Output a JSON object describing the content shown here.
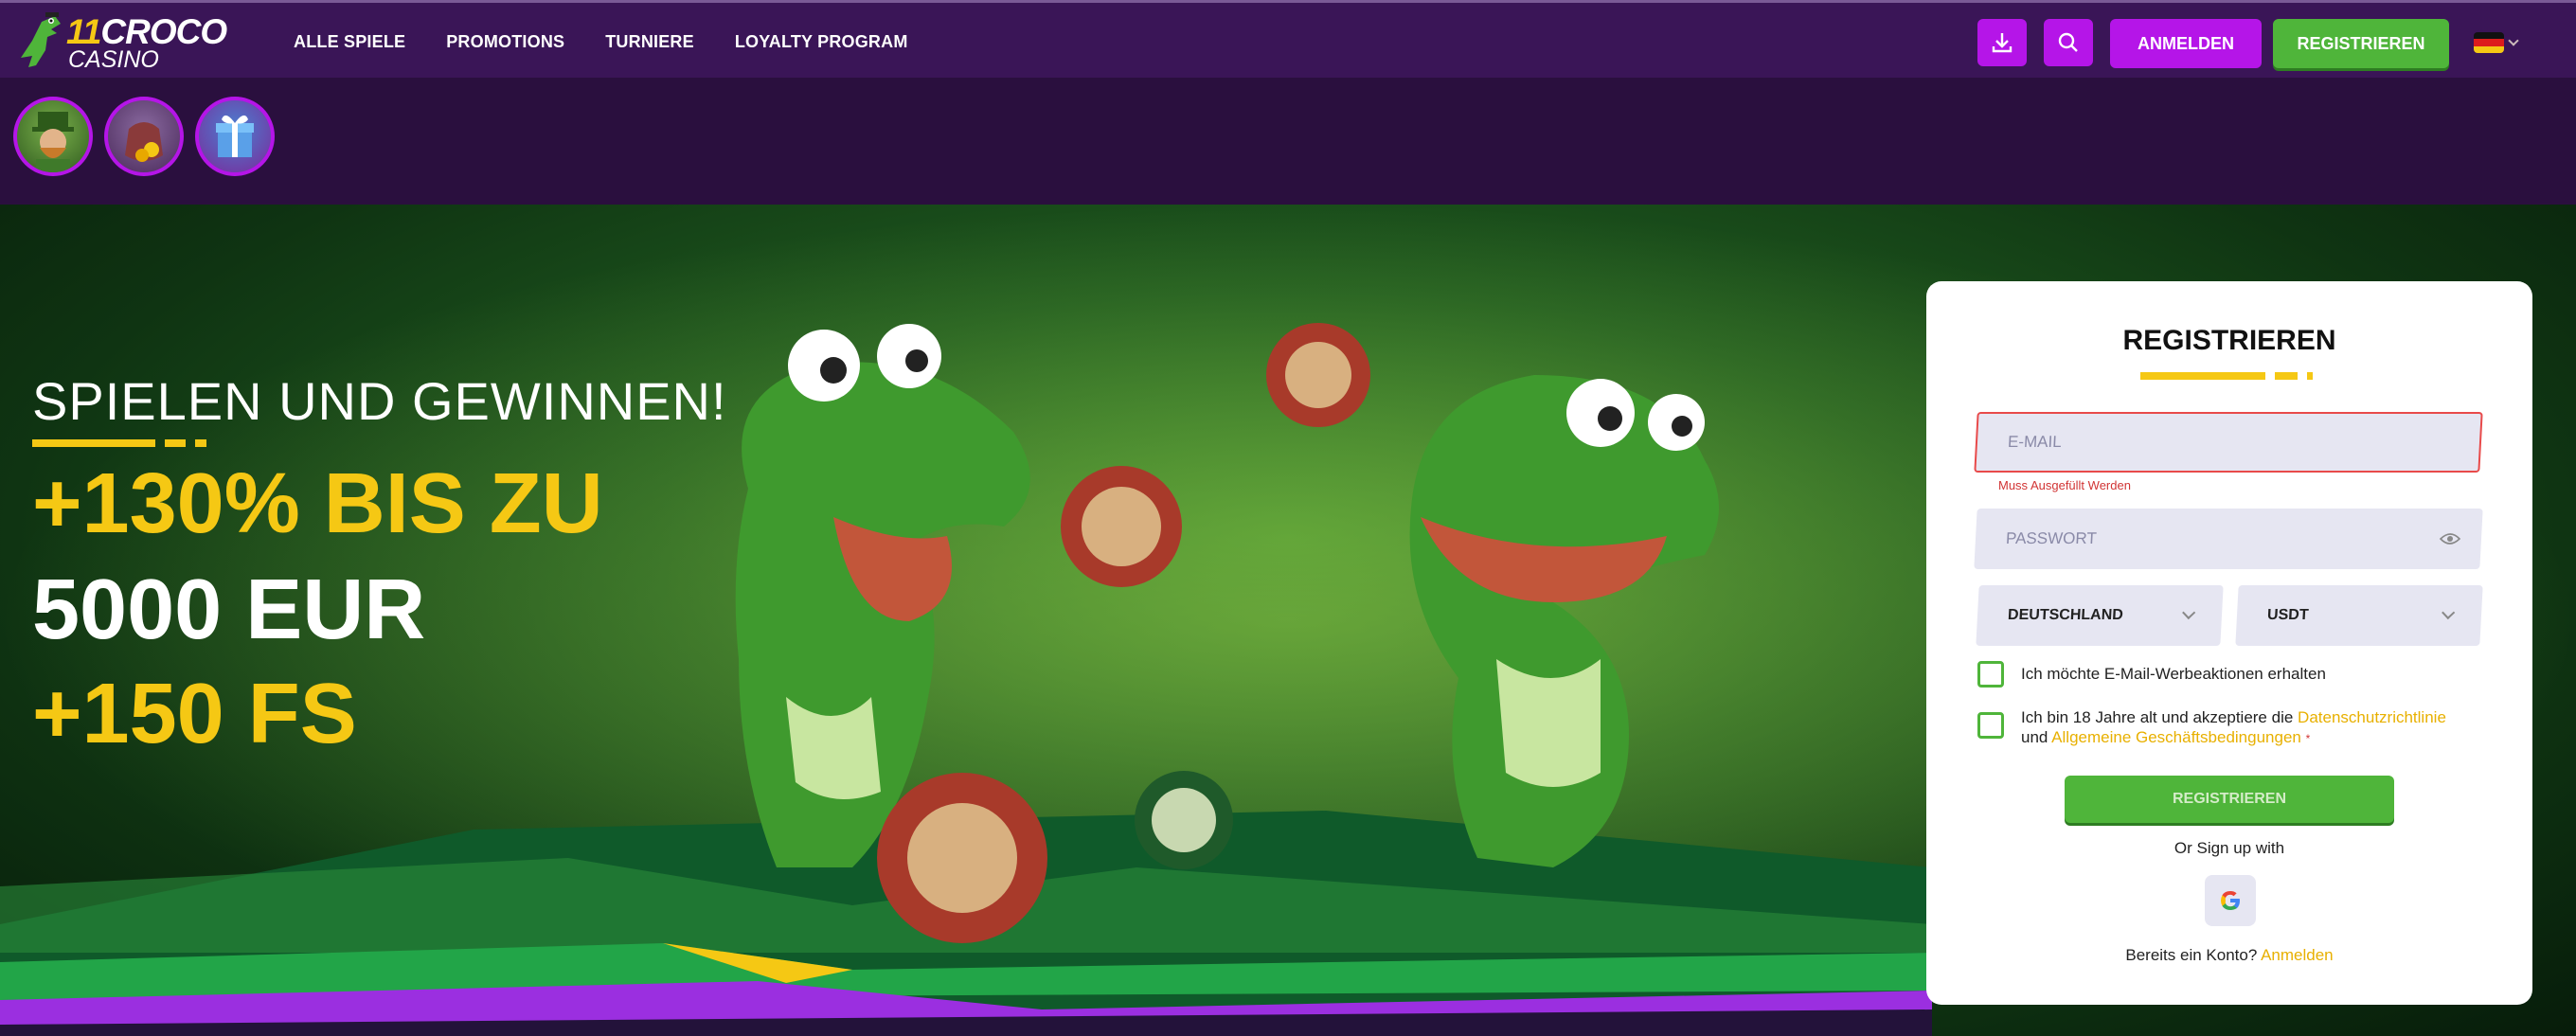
{
  "colors": {
    "brand_purple": "#b515e8",
    "brand_green": "#4fb53a",
    "accent_yellow": "#f5c814",
    "topbar_bg": "#3a1557"
  },
  "logo": {
    "number": "11",
    "word": "CROCO",
    "sub": "CASINO",
    "icon": "crocodile-logo-icon"
  },
  "nav": {
    "items": [
      {
        "label": "ALLE SPIELE"
      },
      {
        "label": "PROMOTIONS"
      },
      {
        "label": "TURNIERE"
      },
      {
        "label": "LOYALTY PROGRAM"
      }
    ]
  },
  "header": {
    "download_icon": "download-icon",
    "search_icon": "search-icon",
    "login_label": "ANMELDEN",
    "register_label": "REGISTRIEREN",
    "language_icon": "german-flag-icon"
  },
  "promos": [
    {
      "icon": "leprechaun-avatar-icon"
    },
    {
      "icon": "coin-pouch-icon"
    },
    {
      "icon": "gift-box-icon"
    }
  ],
  "hero": {
    "title": "SPIELEN UND GEWINNEN!",
    "line1": "+130% BIS ZU",
    "line2": "5000 EUR",
    "line3": "+150 FS"
  },
  "form": {
    "title": "REGISTRIEREN",
    "email_placeholder": "E-MAIL",
    "email_error": "Muss Ausgefüllt Werden",
    "password_placeholder": "PASSWORT",
    "country": "DEUTSCHLAND",
    "currency": "USDT",
    "newsletter_label": "Ich möchte E-Mail-Werbeaktionen erhalten",
    "terms_prefix": "Ich bin 18 Jahre alt und akzeptiere die",
    "privacy_link": "Datenschutzrichtlinie",
    "terms_and": "und",
    "terms_link": "Allgemeine Geschäftsbedingungen",
    "required_mark": "*",
    "submit_label": "REGISTRIEREN",
    "or_text": "Or Sign up with",
    "already_text": "Bereits ein Konto?",
    "login_link": "Anmelden"
  }
}
